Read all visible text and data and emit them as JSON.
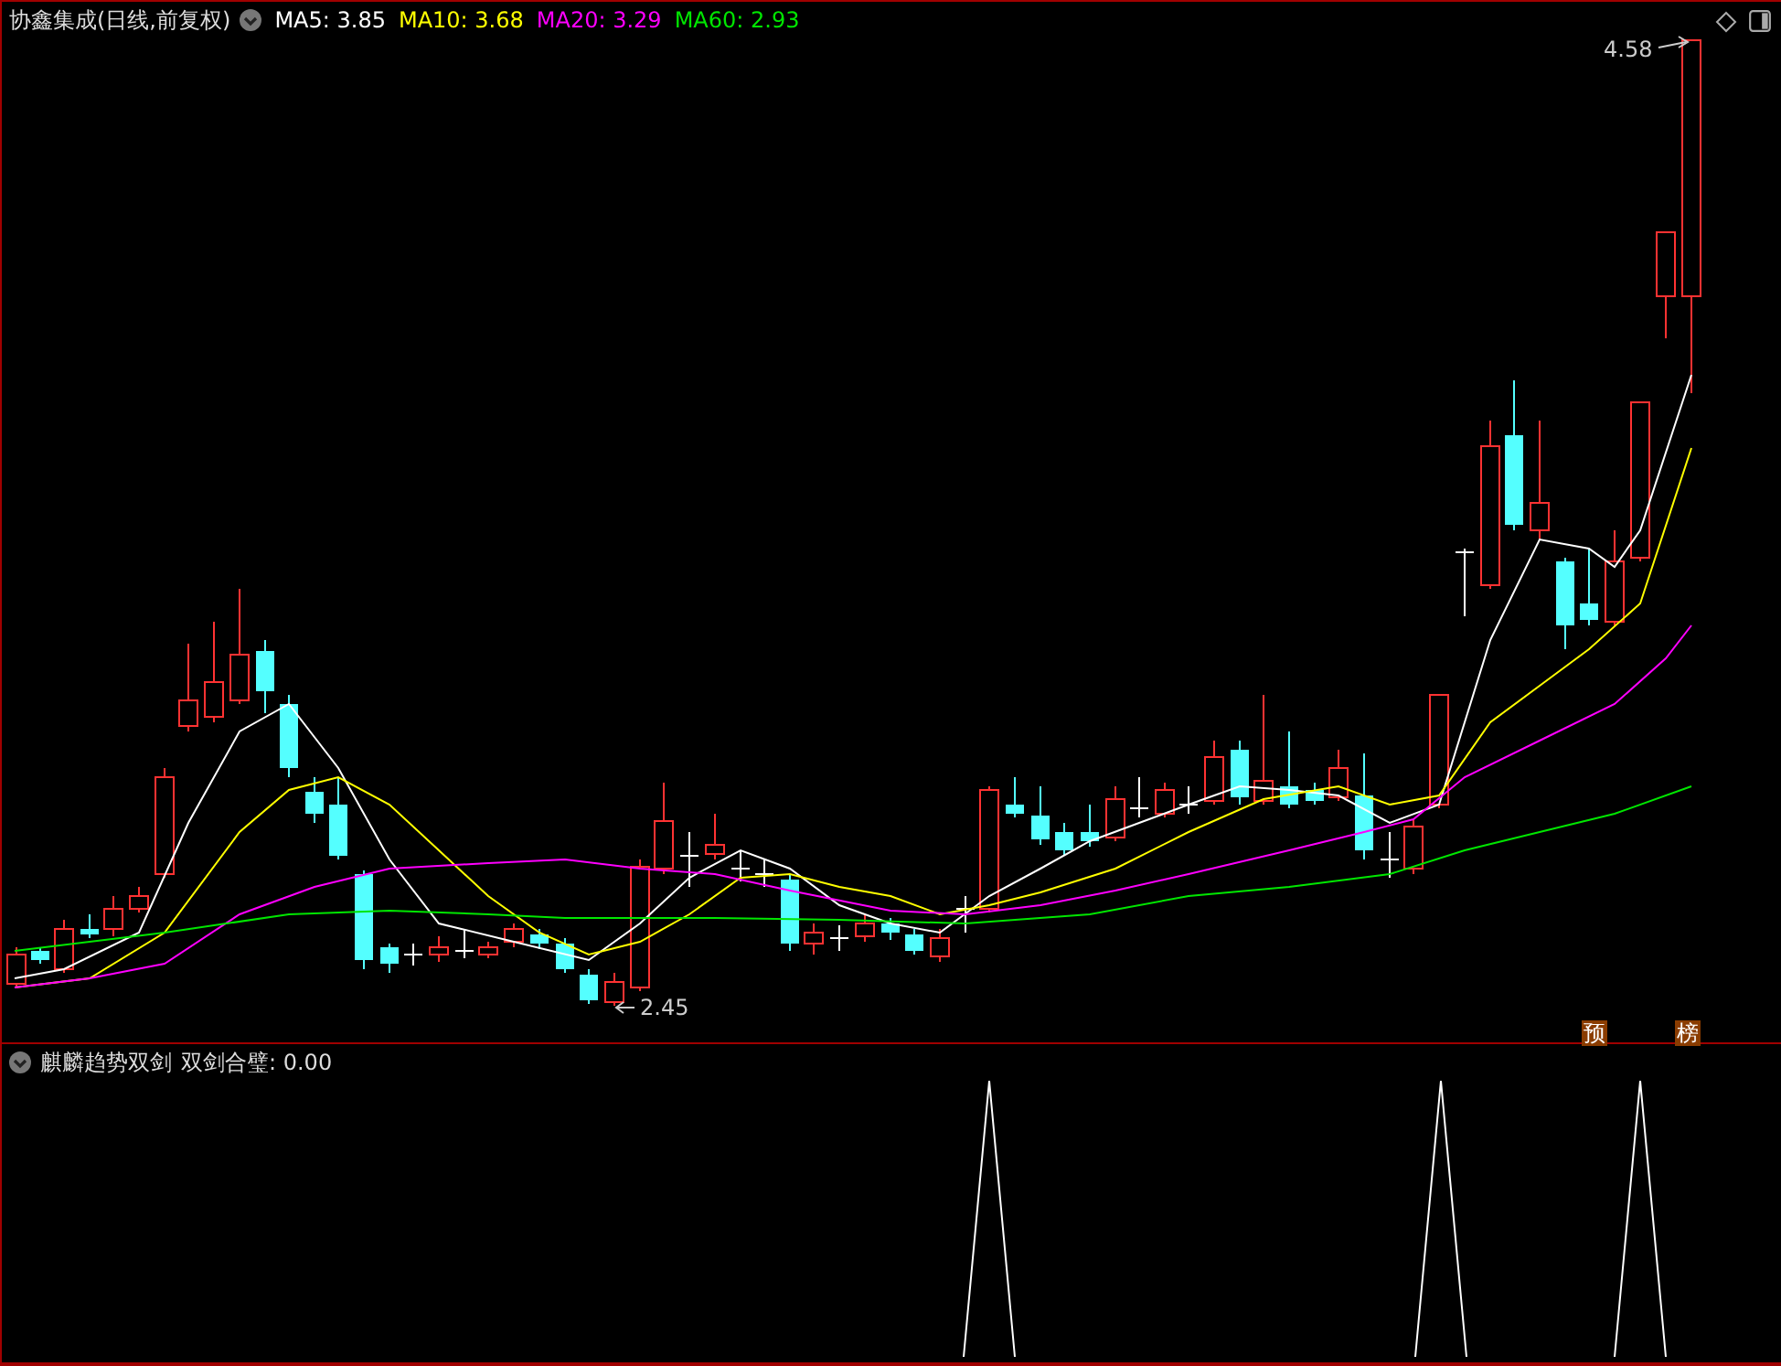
{
  "header": {
    "title": "协鑫集成(日线,前复权)",
    "ma_legend": [
      {
        "label": "MA5: 3.85",
        "color": "#ffffff"
      },
      {
        "label": "MA10: 3.68",
        "color": "#ffff00"
      },
      {
        "label": "MA20: 3.29",
        "color": "#ff00ff"
      },
      {
        "label": "MA60: 2.93",
        "color": "#00e600"
      }
    ]
  },
  "price_labels": {
    "high": "4.58",
    "low": "2.45"
  },
  "markers": [
    "预",
    "榜"
  ],
  "indicator": {
    "name": "麒麟趋势双剑",
    "reading": "双剑合璧: 0.00"
  }
}
